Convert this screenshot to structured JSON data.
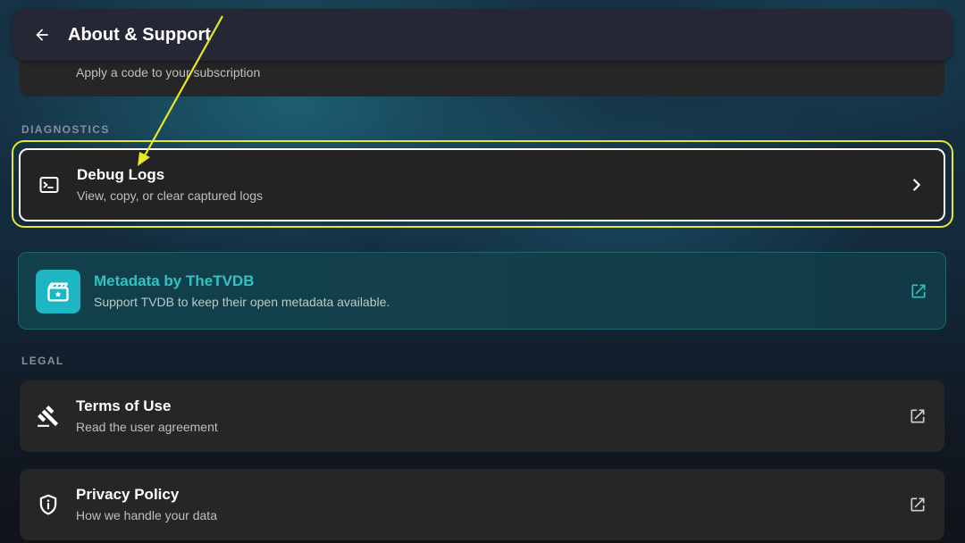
{
  "header": {
    "title": "About & Support",
    "back_icon": "arrow-left-icon"
  },
  "partial_item": {
    "subtitle": "Apply a code to your subscription"
  },
  "sections": {
    "diagnostics": "DIAGNOSTICS",
    "legal": "LEGAL"
  },
  "debug_logs": {
    "title": "Debug Logs",
    "subtitle": "View, copy, or clear captured logs",
    "icon": "terminal-icon",
    "trail_icon": "chevron-right-icon"
  },
  "tvdb": {
    "title": "Metadata by TheTVDB",
    "subtitle": "Support TVDB to keep their open metadata available.",
    "icon": "clapperboard-icon",
    "trail_icon": "external-link-icon",
    "accent": "#2ec4c4"
  },
  "terms": {
    "title": "Terms of Use",
    "subtitle": "Read the user agreement",
    "icon": "gavel-icon",
    "trail_icon": "external-link-icon"
  },
  "privacy": {
    "title": "Privacy Policy",
    "subtitle": "How we handle your data",
    "icon": "shield-info-icon",
    "trail_icon": "external-link-icon"
  },
  "annotation": {
    "color": "#e8e82a"
  }
}
